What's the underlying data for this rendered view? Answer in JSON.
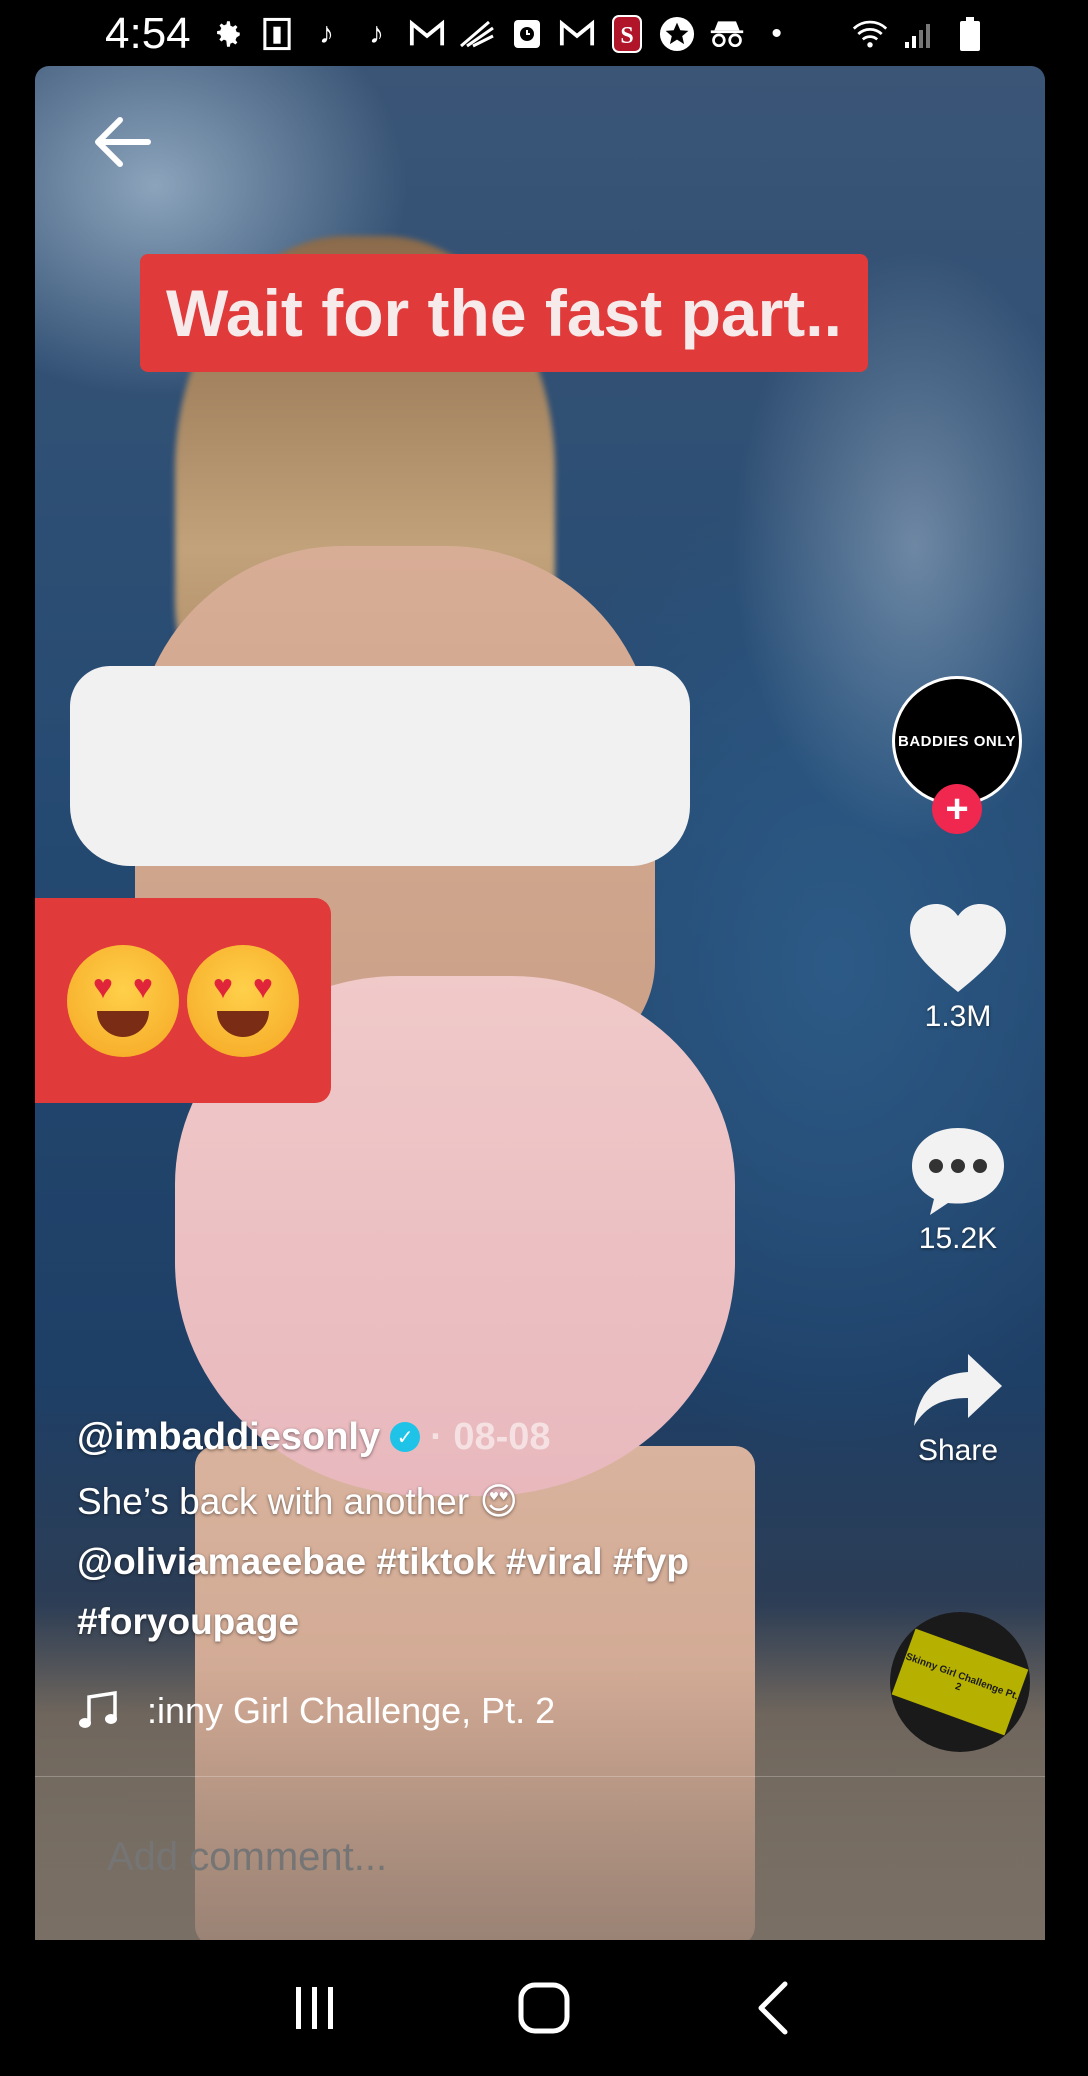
{
  "status_bar": {
    "time": "4:54",
    "icons": [
      "gear-icon",
      "lightbulb-icon",
      "tiktok-icon",
      "tiktok-icon",
      "gmail-icon",
      "delivery-icon",
      "timer-icon",
      "gmail-icon",
      "stanford-icon",
      "star-icon",
      "incognito-icon",
      "dot-icon"
    ],
    "right_icons": [
      "wifi-icon",
      "signal-icon",
      "battery-icon"
    ]
  },
  "video": {
    "caption": "Wait for the fast part..",
    "emoji_caption": "heart-eyes-emoji x2"
  },
  "profile": {
    "avatar_text": "BADDIES ONLY",
    "follow_symbol": "+"
  },
  "actions": {
    "like_count": "1.3M",
    "comment_count": "15.2K",
    "share_label": "Share"
  },
  "post": {
    "username": "@imbaddiesonly",
    "date": "· 08-08",
    "desc_text": "She’s back with another",
    "mention": "@oliviamaeebae",
    "tags": [
      "#tiktok",
      "#viral",
      "#fyp",
      "#foryoupage"
    ]
  },
  "music": {
    "title": ":inny Girl Challenge, Pt. 2",
    "disc_label": "Skinny Girl Challenge Pt. 2"
  },
  "comment": {
    "placeholder": "Add comment..."
  },
  "colors": {
    "caption_bg": "#e03a3a",
    "follow_bg": "#f0274e",
    "verified": "#20c3e8"
  }
}
